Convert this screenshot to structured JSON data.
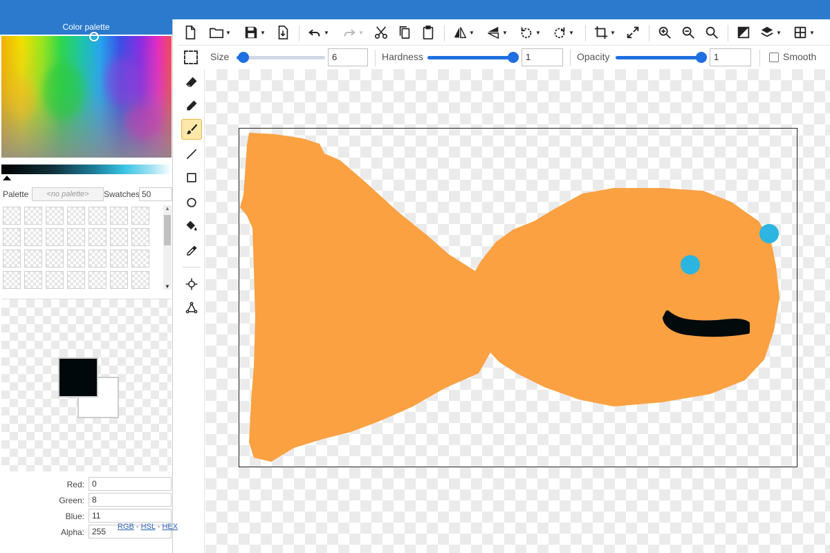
{
  "color_palette": {
    "title": "Color palette",
    "palette_label": "Palette",
    "palette_value": "<no palette>",
    "swatches_label": "Swatches",
    "swatches_value": "50"
  },
  "color_values": {
    "red_label": "Red:",
    "red": "0",
    "green_label": "Green:",
    "green": "8",
    "blue_label": "Blue:",
    "blue": "11",
    "alpha_label": "Alpha:",
    "alpha": "255",
    "mode_rgb": "RGB",
    "mode_hsl": "HSL",
    "mode_hex": "HEX",
    "mode_sep": "-"
  },
  "colors": {
    "primary": "#00080b",
    "secondary": "#ffffff",
    "accent": "#2b7acd",
    "fish": "#fba142",
    "dot": "#2bb5e0"
  },
  "toolbar": {
    "icons": [
      "new-file-icon",
      "open-folder-icon",
      "save-icon",
      "save-as-icon",
      "undo-icon",
      "redo-icon",
      "cut-icon",
      "copy-icon",
      "paste-icon",
      "flip-horizontal-icon",
      "flip-vertical-icon",
      "rotate-left-icon",
      "rotate-right-icon",
      "crop-icon",
      "resize-icon",
      "zoom-in-icon",
      "zoom-out-icon",
      "zoom-fit-icon",
      "effects-icon",
      "layers-icon",
      "grid-icon"
    ]
  },
  "options": {
    "size_label": "Size",
    "size_value": "6",
    "hardness_label": "Hardness",
    "hardness_value": "1",
    "opacity_label": "Opacity",
    "opacity_value": "1",
    "smooth_label": "Smooth",
    "size_level": 0.02,
    "hardness_level": 1.0,
    "opacity_level": 1.0
  },
  "tools": [
    "selection-icon",
    "eraser-icon",
    "pencil-icon",
    "brush-icon",
    "line-icon",
    "rectangle-icon",
    "ellipse-icon",
    "fill-icon",
    "eyedropper-icon",
    "clone-icon",
    "transform-icon"
  ],
  "active_tool": "brush-icon"
}
